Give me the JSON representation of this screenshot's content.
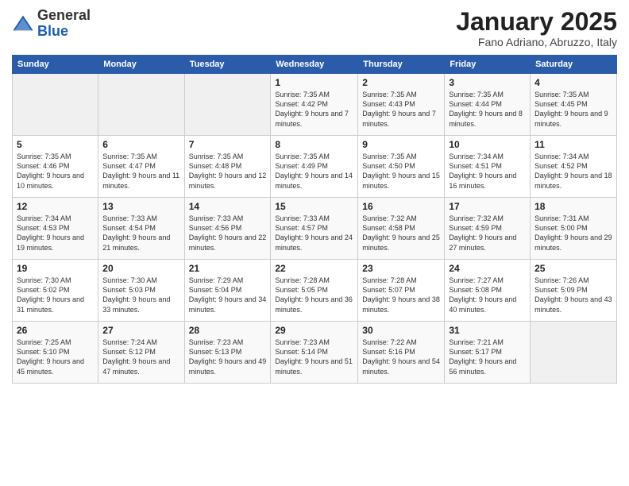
{
  "header": {
    "logo_general": "General",
    "logo_blue": "Blue",
    "month_title": "January 2025",
    "location": "Fano Adriano, Abruzzo, Italy"
  },
  "weekdays": [
    "Sunday",
    "Monday",
    "Tuesday",
    "Wednesday",
    "Thursday",
    "Friday",
    "Saturday"
  ],
  "weeks": [
    [
      {
        "day": "",
        "info": ""
      },
      {
        "day": "",
        "info": ""
      },
      {
        "day": "",
        "info": ""
      },
      {
        "day": "1",
        "info": "Sunrise: 7:35 AM\nSunset: 4:42 PM\nDaylight: 9 hours\nand 7 minutes."
      },
      {
        "day": "2",
        "info": "Sunrise: 7:35 AM\nSunset: 4:43 PM\nDaylight: 9 hours\nand 7 minutes."
      },
      {
        "day": "3",
        "info": "Sunrise: 7:35 AM\nSunset: 4:44 PM\nDaylight: 9 hours\nand 8 minutes."
      },
      {
        "day": "4",
        "info": "Sunrise: 7:35 AM\nSunset: 4:45 PM\nDaylight: 9 hours\nand 9 minutes."
      }
    ],
    [
      {
        "day": "5",
        "info": "Sunrise: 7:35 AM\nSunset: 4:46 PM\nDaylight: 9 hours\nand 10 minutes."
      },
      {
        "day": "6",
        "info": "Sunrise: 7:35 AM\nSunset: 4:47 PM\nDaylight: 9 hours\nand 11 minutes."
      },
      {
        "day": "7",
        "info": "Sunrise: 7:35 AM\nSunset: 4:48 PM\nDaylight: 9 hours\nand 12 minutes."
      },
      {
        "day": "8",
        "info": "Sunrise: 7:35 AM\nSunset: 4:49 PM\nDaylight: 9 hours\nand 14 minutes."
      },
      {
        "day": "9",
        "info": "Sunrise: 7:35 AM\nSunset: 4:50 PM\nDaylight: 9 hours\nand 15 minutes."
      },
      {
        "day": "10",
        "info": "Sunrise: 7:34 AM\nSunset: 4:51 PM\nDaylight: 9 hours\nand 16 minutes."
      },
      {
        "day": "11",
        "info": "Sunrise: 7:34 AM\nSunset: 4:52 PM\nDaylight: 9 hours\nand 18 minutes."
      }
    ],
    [
      {
        "day": "12",
        "info": "Sunrise: 7:34 AM\nSunset: 4:53 PM\nDaylight: 9 hours\nand 19 minutes."
      },
      {
        "day": "13",
        "info": "Sunrise: 7:33 AM\nSunset: 4:54 PM\nDaylight: 9 hours\nand 21 minutes."
      },
      {
        "day": "14",
        "info": "Sunrise: 7:33 AM\nSunset: 4:56 PM\nDaylight: 9 hours\nand 22 minutes."
      },
      {
        "day": "15",
        "info": "Sunrise: 7:33 AM\nSunset: 4:57 PM\nDaylight: 9 hours\nand 24 minutes."
      },
      {
        "day": "16",
        "info": "Sunrise: 7:32 AM\nSunset: 4:58 PM\nDaylight: 9 hours\nand 25 minutes."
      },
      {
        "day": "17",
        "info": "Sunrise: 7:32 AM\nSunset: 4:59 PM\nDaylight: 9 hours\nand 27 minutes."
      },
      {
        "day": "18",
        "info": "Sunrise: 7:31 AM\nSunset: 5:00 PM\nDaylight: 9 hours\nand 29 minutes."
      }
    ],
    [
      {
        "day": "19",
        "info": "Sunrise: 7:30 AM\nSunset: 5:02 PM\nDaylight: 9 hours\nand 31 minutes."
      },
      {
        "day": "20",
        "info": "Sunrise: 7:30 AM\nSunset: 5:03 PM\nDaylight: 9 hours\nand 33 minutes."
      },
      {
        "day": "21",
        "info": "Sunrise: 7:29 AM\nSunset: 5:04 PM\nDaylight: 9 hours\nand 34 minutes."
      },
      {
        "day": "22",
        "info": "Sunrise: 7:28 AM\nSunset: 5:05 PM\nDaylight: 9 hours\nand 36 minutes."
      },
      {
        "day": "23",
        "info": "Sunrise: 7:28 AM\nSunset: 5:07 PM\nDaylight: 9 hours\nand 38 minutes."
      },
      {
        "day": "24",
        "info": "Sunrise: 7:27 AM\nSunset: 5:08 PM\nDaylight: 9 hours\nand 40 minutes."
      },
      {
        "day": "25",
        "info": "Sunrise: 7:26 AM\nSunset: 5:09 PM\nDaylight: 9 hours\nand 43 minutes."
      }
    ],
    [
      {
        "day": "26",
        "info": "Sunrise: 7:25 AM\nSunset: 5:10 PM\nDaylight: 9 hours\nand 45 minutes."
      },
      {
        "day": "27",
        "info": "Sunrise: 7:24 AM\nSunset: 5:12 PM\nDaylight: 9 hours\nand 47 minutes."
      },
      {
        "day": "28",
        "info": "Sunrise: 7:23 AM\nSunset: 5:13 PM\nDaylight: 9 hours\nand 49 minutes."
      },
      {
        "day": "29",
        "info": "Sunrise: 7:23 AM\nSunset: 5:14 PM\nDaylight: 9 hours\nand 51 minutes."
      },
      {
        "day": "30",
        "info": "Sunrise: 7:22 AM\nSunset: 5:16 PM\nDaylight: 9 hours\nand 54 minutes."
      },
      {
        "day": "31",
        "info": "Sunrise: 7:21 AM\nSunset: 5:17 PM\nDaylight: 9 hours\nand 56 minutes."
      },
      {
        "day": "",
        "info": ""
      }
    ]
  ]
}
